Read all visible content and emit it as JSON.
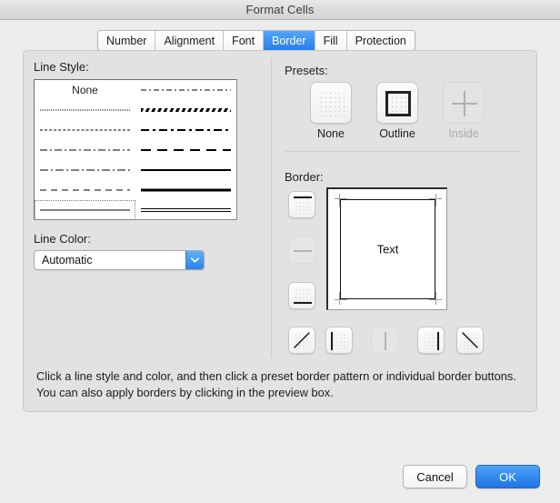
{
  "window": {
    "title": "Format Cells"
  },
  "tabs": [
    {
      "label": "Number",
      "active": false
    },
    {
      "label": "Alignment",
      "active": false
    },
    {
      "label": "Font",
      "active": false
    },
    {
      "label": "Border",
      "active": true
    },
    {
      "label": "Fill",
      "active": false
    },
    {
      "label": "Protection",
      "active": false
    }
  ],
  "line_style": {
    "label": "Line Style:",
    "none_label": "None",
    "selected_index": 12,
    "styles": [
      {
        "index": 0,
        "name": "none",
        "column": "left",
        "row": 0
      },
      {
        "index": 1,
        "name": "dash-dot-fine",
        "column": "right",
        "row": 0
      },
      {
        "index": 2,
        "name": "dotted-fine",
        "column": "left",
        "row": 1
      },
      {
        "index": 3,
        "name": "hatched",
        "column": "right",
        "row": 1
      },
      {
        "index": 4,
        "name": "dotted",
        "column": "left",
        "row": 2
      },
      {
        "index": 5,
        "name": "dash-dot-bold",
        "column": "right",
        "row": 2
      },
      {
        "index": 6,
        "name": "dash-dot-thin",
        "column": "left",
        "row": 3
      },
      {
        "index": 7,
        "name": "dashed-bold",
        "column": "right",
        "row": 3
      },
      {
        "index": 8,
        "name": "dash-dot-thin-2",
        "column": "left",
        "row": 4
      },
      {
        "index": 9,
        "name": "solid-medium",
        "column": "right",
        "row": 4
      },
      {
        "index": 10,
        "name": "dashed-medium",
        "column": "left",
        "row": 5
      },
      {
        "index": 11,
        "name": "solid-bold",
        "column": "right",
        "row": 5
      },
      {
        "index": 12,
        "name": "solid-thin",
        "column": "left",
        "row": 6
      },
      {
        "index": 13,
        "name": "double",
        "column": "right",
        "row": 6
      }
    ]
  },
  "line_color": {
    "label": "Line Color:",
    "value": "Automatic"
  },
  "presets": {
    "label": "Presets:",
    "items": [
      {
        "id": "none",
        "caption": "None",
        "enabled": true,
        "selected": false
      },
      {
        "id": "outline",
        "caption": "Outline",
        "enabled": true,
        "selected": true
      },
      {
        "id": "inside",
        "caption": "Inside",
        "enabled": false,
        "selected": false
      }
    ]
  },
  "border": {
    "label": "Border:",
    "side_buttons": [
      {
        "id": "border-top",
        "enabled": true
      },
      {
        "id": "border-horizontal-mid",
        "enabled": false
      },
      {
        "id": "border-bottom",
        "enabled": true
      }
    ],
    "bottom_buttons": [
      {
        "id": "border-diagonal-up",
        "enabled": true
      },
      {
        "id": "border-left",
        "enabled": true
      },
      {
        "id": "border-vertical-mid",
        "enabled": false
      },
      {
        "id": "border-right",
        "enabled": true
      },
      {
        "id": "border-diagonal-down",
        "enabled": true
      }
    ],
    "preview_text": "Text"
  },
  "help_text": "Click a line style and color, and then click a preset border pattern or individual border buttons. You can also apply borders by clicking in the preview box.",
  "footer": {
    "cancel_label": "Cancel",
    "ok_label": "OK"
  },
  "colors": {
    "accent_blue": "#2b7ee8",
    "dialog_background": "#ececec",
    "panel_background": "#e2e2e2",
    "disabled_text": "#a9a9a9"
  }
}
